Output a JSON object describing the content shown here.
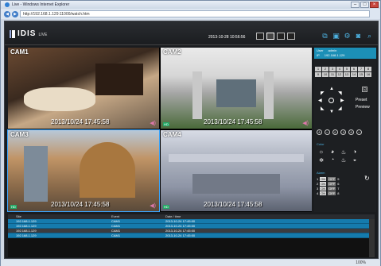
{
  "browser": {
    "title": "Live - Windows Internet Explorer",
    "address": "http://192.168.1.129:11000/watch.htm",
    "status_zoom": "100%"
  },
  "app": {
    "logo": "IDIS",
    "logo_sub": "LIVE",
    "datetime": "2013-10-28 10:56:56",
    "user_label": "User",
    "user_value": "admin",
    "ip_label": "IP",
    "ip_value": "192.168.1.129"
  },
  "cameras": [
    {
      "label": "CAM1",
      "timestamp": "2013/10/24 17:45:58"
    },
    {
      "label": "CAM2",
      "timestamp": "2013/10/24 17:45:58"
    },
    {
      "label": "CAM3",
      "timestamp": "2013/10/24 17:45:58"
    },
    {
      "label": "CAM4",
      "timestamp": "2013/10/24 17:45:58"
    }
  ],
  "camera_buttons": [
    "1",
    "2",
    "3",
    "4",
    "5",
    "6",
    "7",
    "8",
    "9",
    "10",
    "11",
    "12",
    "13",
    "14",
    "15",
    "16"
  ],
  "ptz": {
    "preset": "Preset",
    "preview": "Preview"
  },
  "sections": {
    "color": "Color",
    "alarm": "Alarm"
  },
  "alarms": [
    {
      "left": "1",
      "right": "5"
    },
    {
      "left": "2",
      "right": "6"
    },
    {
      "left": "3",
      "right": "7"
    },
    {
      "left": "4",
      "right": "8"
    }
  ],
  "alarm_on": "ON",
  "alarm_off": "OFF",
  "event_log": {
    "headers": [
      "Site",
      "Event",
      "Date / time"
    ],
    "rows": [
      {
        "site": "192.168.1.129",
        "event": "CAM1",
        "datetime": "2013-10-24 17:45:00"
      },
      {
        "site": "192.168.1.129",
        "event": "CAM1",
        "datetime": "2013-10-24 17:45:00"
      },
      {
        "site": "192.168.1.129",
        "event": "CAM1",
        "datetime": "2013-10-24 17:45:00"
      },
      {
        "site": "192.168.1.129",
        "event": "CAM1",
        "datetime": "2013-10-24 17:45:00"
      }
    ]
  },
  "accent_color": "#1c8fb6"
}
